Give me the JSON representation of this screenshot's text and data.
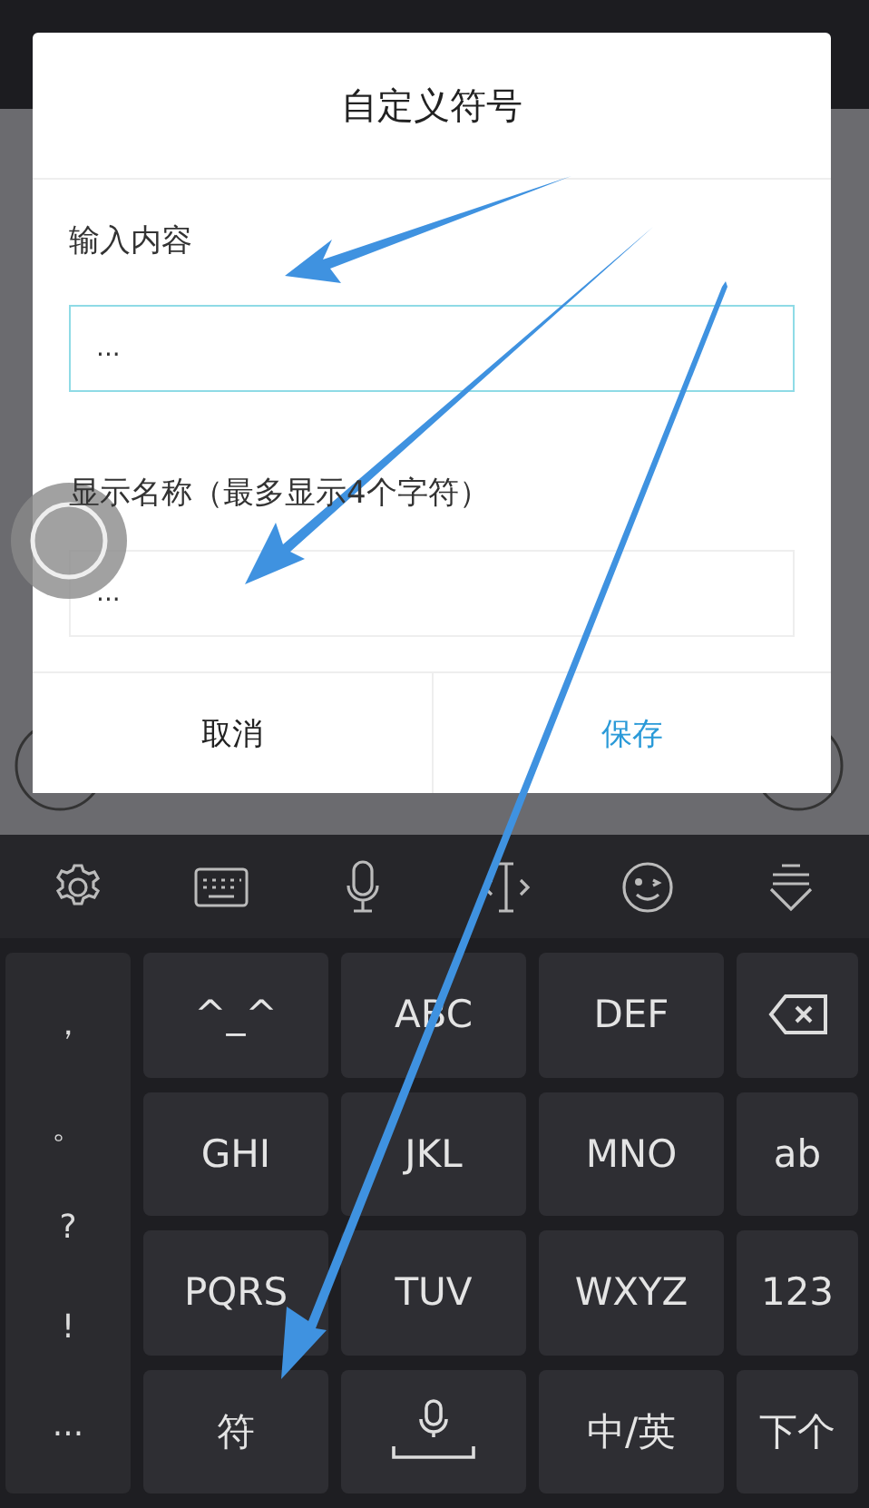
{
  "dialog": {
    "title": "自定义符号",
    "fields": [
      {
        "label": "输入内容",
        "value": "...",
        "focused": true
      },
      {
        "label": "显示名称（最多显示4个字符）",
        "value": "...",
        "focused": false
      }
    ],
    "buttons": [
      {
        "label": "取消",
        "kind": "cancel"
      },
      {
        "label": "保存",
        "kind": "primary"
      }
    ]
  },
  "keyboard": {
    "toolbar": [
      {
        "kind": "settings"
      },
      {
        "kind": "keyboard"
      },
      {
        "kind": "mic"
      },
      {
        "kind": "cursor"
      },
      {
        "kind": "emoji"
      },
      {
        "kind": "hide"
      }
    ],
    "symbols": [
      "，",
      "。",
      "?",
      "!",
      "..."
    ],
    "keys": [
      {
        "kind": "text",
        "label": "^_^"
      },
      {
        "kind": "text",
        "label": "ABC"
      },
      {
        "kind": "text",
        "label": "DEF"
      },
      {
        "kind": "backspace"
      },
      {
        "kind": "text",
        "label": "GHI"
      },
      {
        "kind": "text",
        "label": "JKL"
      },
      {
        "kind": "text",
        "label": "MNO"
      },
      {
        "kind": "text",
        "label": "ab"
      },
      {
        "kind": "text",
        "label": "PQRS"
      },
      {
        "kind": "text",
        "label": "TUV"
      },
      {
        "kind": "text",
        "label": "WXYZ"
      },
      {
        "kind": "text",
        "label": "123"
      },
      {
        "kind": "text",
        "label": "符"
      },
      {
        "kind": "space"
      },
      {
        "kind": "text",
        "label": "中/英"
      },
      {
        "kind": "text",
        "label": "下个"
      }
    ]
  }
}
